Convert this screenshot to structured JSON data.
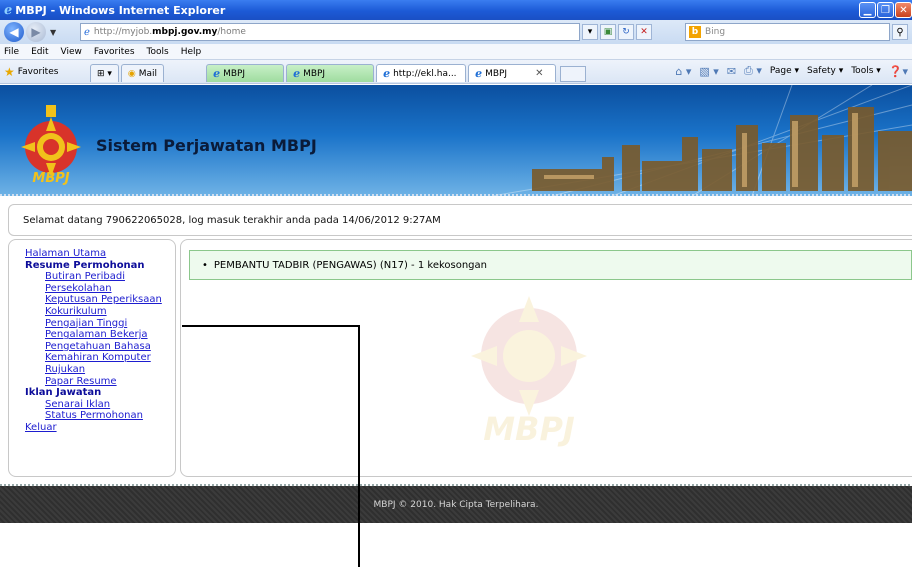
{
  "window": {
    "title": "MBPJ - Windows Internet Explorer"
  },
  "address": {
    "url_prefix": "http://myjob.",
    "url_domain": "mbpj.gov.my",
    "url_suffix": "/home",
    "search_placeholder": "Bing"
  },
  "menu": [
    "File",
    "Edit",
    "View",
    "Favorites",
    "Tools",
    "Help"
  ],
  "favorites": {
    "label": "Favorites",
    "mail_label": "Mail"
  },
  "tabs": [
    {
      "label": "MBPJ"
    },
    {
      "label": "MBPJ"
    },
    {
      "label": "http://ekl.ha..."
    },
    {
      "label": "MBPJ"
    }
  ],
  "commandbar": {
    "page": "Page ▾",
    "safety": "Safety ▾",
    "tools": "Tools ▾"
  },
  "banner": {
    "title": "Sistem Perjawatan MBPJ",
    "logo_text": "MBPJ"
  },
  "welcome": {
    "text": "Selamat datang 790622065028, log masuk terakhir anda pada 14/06/2012 9:27AM"
  },
  "sidebar": {
    "home": "Halaman Utama",
    "resume_head": "Resume Permohonan",
    "resume_items": [
      "Butiran Peribadi",
      "Persekolahan",
      "Keputusan Peperiksaan",
      "Kokurikulum",
      "Pengajian Tinggi",
      "Pengalaman Bekerja",
      "Pengetahuan Bahasa",
      "Kemahiran Komputer",
      "Rujukan",
      "Papar Resume"
    ],
    "ads_head": "Iklan Jawatan",
    "ads_items": [
      "Senarai Iklan",
      "Status Permohonan"
    ],
    "logout": "Keluar"
  },
  "content": {
    "vacancy": "PEMBANTU TADBIR (PENGAWAS) (N17) - 1 kekosongan",
    "watermark_text": "MBPJ"
  },
  "footer": {
    "text": "MBPJ © 2010. Hak Cipta Terpelihara."
  },
  "colors": {
    "link": "#1d1dcf",
    "heading": "#0d0d9a",
    "vacancy_bg": "#eefaee",
    "vacancy_border": "#8cc78c",
    "footer_bg": "#333333"
  }
}
